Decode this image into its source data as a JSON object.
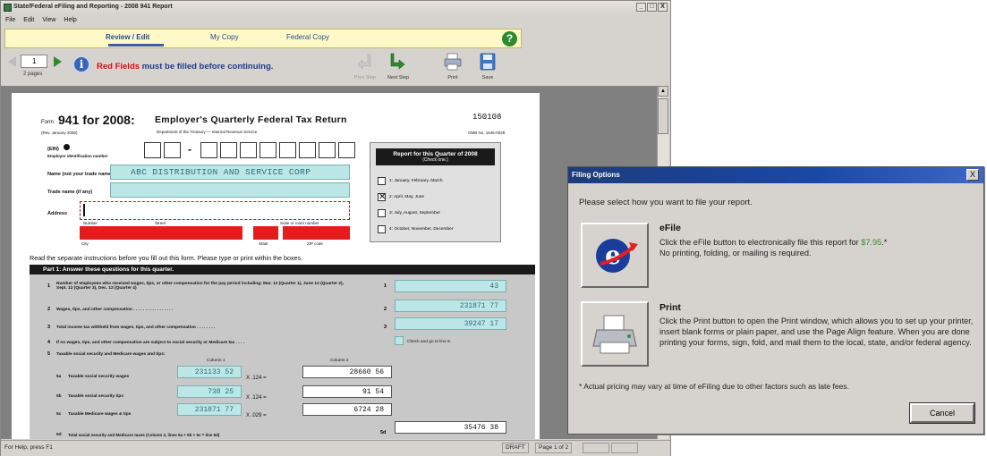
{
  "window": {
    "title": "State/Federal eFiling and Reporting - 2008 941 Report",
    "controls": [
      "_",
      "□",
      "X"
    ]
  },
  "menu": [
    "File",
    "Edit",
    "View",
    "Help"
  ],
  "tabs": [
    "Review / Edit",
    "My Copy",
    "Federal Copy"
  ],
  "nav": {
    "page": "1",
    "pages_label": "2 pages",
    "msg_red": "Red Fields",
    "msg_rest": " must be filled before continuing."
  },
  "toolbar": {
    "prev": "Prev Step",
    "next": "Next Step",
    "print": "Print",
    "save": "Save"
  },
  "form": {
    "form_label": "Form",
    "number": "941 for 2008:",
    "title": "Employer's Quarterly Federal Tax Return",
    "revision": "(Rev. January 2008)",
    "department": "Department of the Treasury — Internal Revenue Service",
    "code": "150108",
    "omb": "OMB No. 1545-0029",
    "ein_label": "(EIN)",
    "ein_sub": "Employer identification number",
    "ein_dash": "-",
    "name_label": "Name (not your trade name)",
    "name_value": "ABC DISTRIBUTION AND SERVICE CORP",
    "trade_label": "Trade name (if any)",
    "address_label": "Address",
    "addr_sub": [
      "Number",
      "Street",
      "Suite or room number"
    ],
    "city_sub": [
      "City",
      "State",
      "ZIP code"
    ],
    "instructions": "Read the separate instructions before you fill out this form. Please type or print within the boxes.",
    "quarter_box": {
      "header": "Report for this Quarter of 2008",
      "header_sub": "(Check one.)",
      "options": [
        "1: January, February, March",
        "2: April, May, June",
        "3: July, August, September",
        "4: October, November, December"
      ],
      "checked": 2
    },
    "part1": "Part 1: Answer these questions for this quarter.",
    "lines": [
      {
        "num": "1",
        "text": "Number of employees who received wages, tips, or other compensation for the pay period including: Mar. 12 (Quarter 1), June 12 (Quarter 2), Sept. 12 (Quarter 3), Dec. 12 (Quarter 4)",
        "box": "1",
        "value": "43"
      },
      {
        "num": "2",
        "text": "Wages, tips, and other compensation . . . . . . . . . . . . . . . . .",
        "box": "2",
        "value": "231871 77"
      },
      {
        "num": "3",
        "text": "Total income tax withheld from wages, tips, and other compensation . . . . . . . .",
        "box": "3",
        "value": "39247 17"
      },
      {
        "num": "4",
        "text": "If no wages, tips, and other compensation are subject to social security or Medicare tax . . . .",
        "box": "",
        "value": "Check and go to line 6."
      },
      {
        "num": "5",
        "text": "Taxable social security and Medicare wages and tips:",
        "box": "",
        "value": ""
      }
    ],
    "col1": "Column 1",
    "col2": "Column 2",
    "sub_lines": [
      {
        "num": "5a",
        "text": "Taxable social security wages",
        "c1": "231133 52",
        "mult": "X .124 =",
        "c2": "28660 56"
      },
      {
        "num": "5b",
        "text": "Taxable social security tips",
        "c1": "738 25",
        "mult": "X .124 =",
        "c2": "91 54"
      },
      {
        "num": "5c",
        "text": "Taxable Medicare wages & tips",
        "c1": "231871 77",
        "mult": "X .029 =",
        "c2": "6724 28"
      }
    ],
    "line5d": {
      "num": "5d",
      "text": "Total social security and Medicare taxes (Column 2, lines 5a + 5b + 5c = line 5d)",
      "box": "5d",
      "value": "35476 38"
    }
  },
  "status": {
    "help": "For Help, press F1",
    "draft": "DRAFT",
    "page": "Page 1 of 2"
  },
  "dialog": {
    "title": "Filing Options",
    "prompt": "Please select how you want to file your report.",
    "efile": {
      "title": "eFile",
      "desc1": "Click the eFile button to electronically file this report for ",
      "price": "$7.95",
      "desc2": ".*",
      "desc3": "No printing, folding, or mailing is required."
    },
    "print": {
      "title": "Print",
      "desc": "Click the Print button to open the Print window, which allows you to set up your printer, insert blank forms or plain paper, and use the Page Align feature. When you are done printing your forms, sign, fold, and mail them to the local, state, and/or federal agency."
    },
    "note": "* Actual pricing may vary at time of eFiling due to other factors such as late fees.",
    "cancel": "Cancel",
    "close": "X"
  },
  "colors": {
    "red_field": "#e41c1c",
    "teal_field": "#bde6e6",
    "dialog_title": "#1a48a8",
    "price": "#2e8b2e"
  }
}
